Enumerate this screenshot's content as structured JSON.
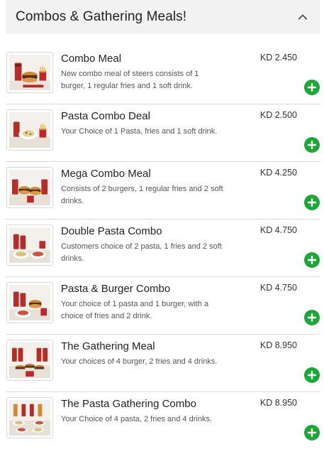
{
  "section": {
    "title": "Combos & Gathering Meals!",
    "collapse_icon": "chevron-up-icon"
  },
  "colors": {
    "add_button": "#1ca834",
    "header_bg": "#f2f2f2"
  },
  "items": [
    {
      "name": "Combo Meal",
      "price": "KD 2.450",
      "description": "New combo meal of steers consists of 1 burger, 1 regular fries and 1 soft drink."
    },
    {
      "name": "Pasta Combo Deal",
      "price": "KD 2.500",
      "description": "Your Choice of 1 Pasta, fries and 1 soft drink."
    },
    {
      "name": "Mega Combo Meal",
      "price": "KD 4.250",
      "description": "Consists of 2 burgers, 1 regular fries and 2 soft drinks."
    },
    {
      "name": "Double Pasta Combo",
      "price": "KD 4.750",
      "description": "Customers choice of 2 pasta, 1 fries and 2 soft drinks."
    },
    {
      "name": "Pasta & Burger Combo",
      "price": "KD 4.750",
      "description": "Your choice of 1 pasta and 1 burger, with a choice of fries and 2 drink."
    },
    {
      "name": "The Gathering Meal",
      "price": "KD 8.950",
      "description": "Your choices of 4 burger, 2 fries and 4 drinks."
    },
    {
      "name": "The Pasta Gathering Combo",
      "price": "KD 8.950",
      "description": "Your Choice of 4 pasta, 2 fries and 4 drinks."
    }
  ]
}
